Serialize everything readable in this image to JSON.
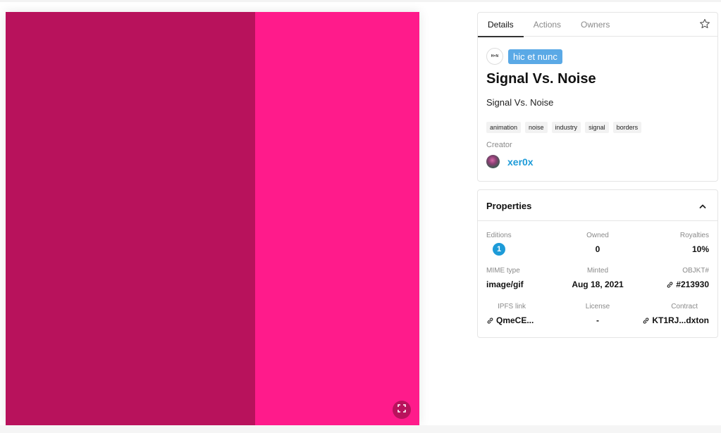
{
  "colors": {
    "art_left": "#b8125c",
    "art_right": "#ff1b8b",
    "fullscreen_button_bg": "#b8125c",
    "link_blue": "#1d9bd8",
    "badge_blue": "#5aa9e6"
  },
  "artwork": {
    "fullscreen_icon": "expand-icon"
  },
  "tabs": [
    {
      "label": "Details",
      "active": true
    },
    {
      "label": "Actions",
      "active": false
    },
    {
      "label": "Owners",
      "active": false
    }
  ],
  "collection": {
    "logo_text": "H=N",
    "name": "hic et nunc"
  },
  "token": {
    "title": "Signal Vs. Noise",
    "description": "Signal Vs. Noise",
    "tags": [
      "animation",
      "noise",
      "industry",
      "signal",
      "borders"
    ]
  },
  "creator": {
    "label": "Creator",
    "name": "xer0x"
  },
  "properties": {
    "title": "Properties",
    "editions_label": "Editions",
    "editions_value": "1",
    "owned_label": "Owned",
    "owned_value": "0",
    "royalties_label": "Royalties",
    "royalties_value": "10%",
    "mime_label": "MIME type",
    "mime_value": "image/gif",
    "minted_label": "Minted",
    "minted_value": "Aug 18, 2021",
    "objkt_label": "OBJKT#",
    "objkt_value": "#213930",
    "ipfs_label": "IPFS link",
    "ipfs_value": "QmeCE...",
    "license_label": "License",
    "license_value": "-",
    "contract_label": "Contract",
    "contract_value": "KT1RJ...dxton"
  }
}
